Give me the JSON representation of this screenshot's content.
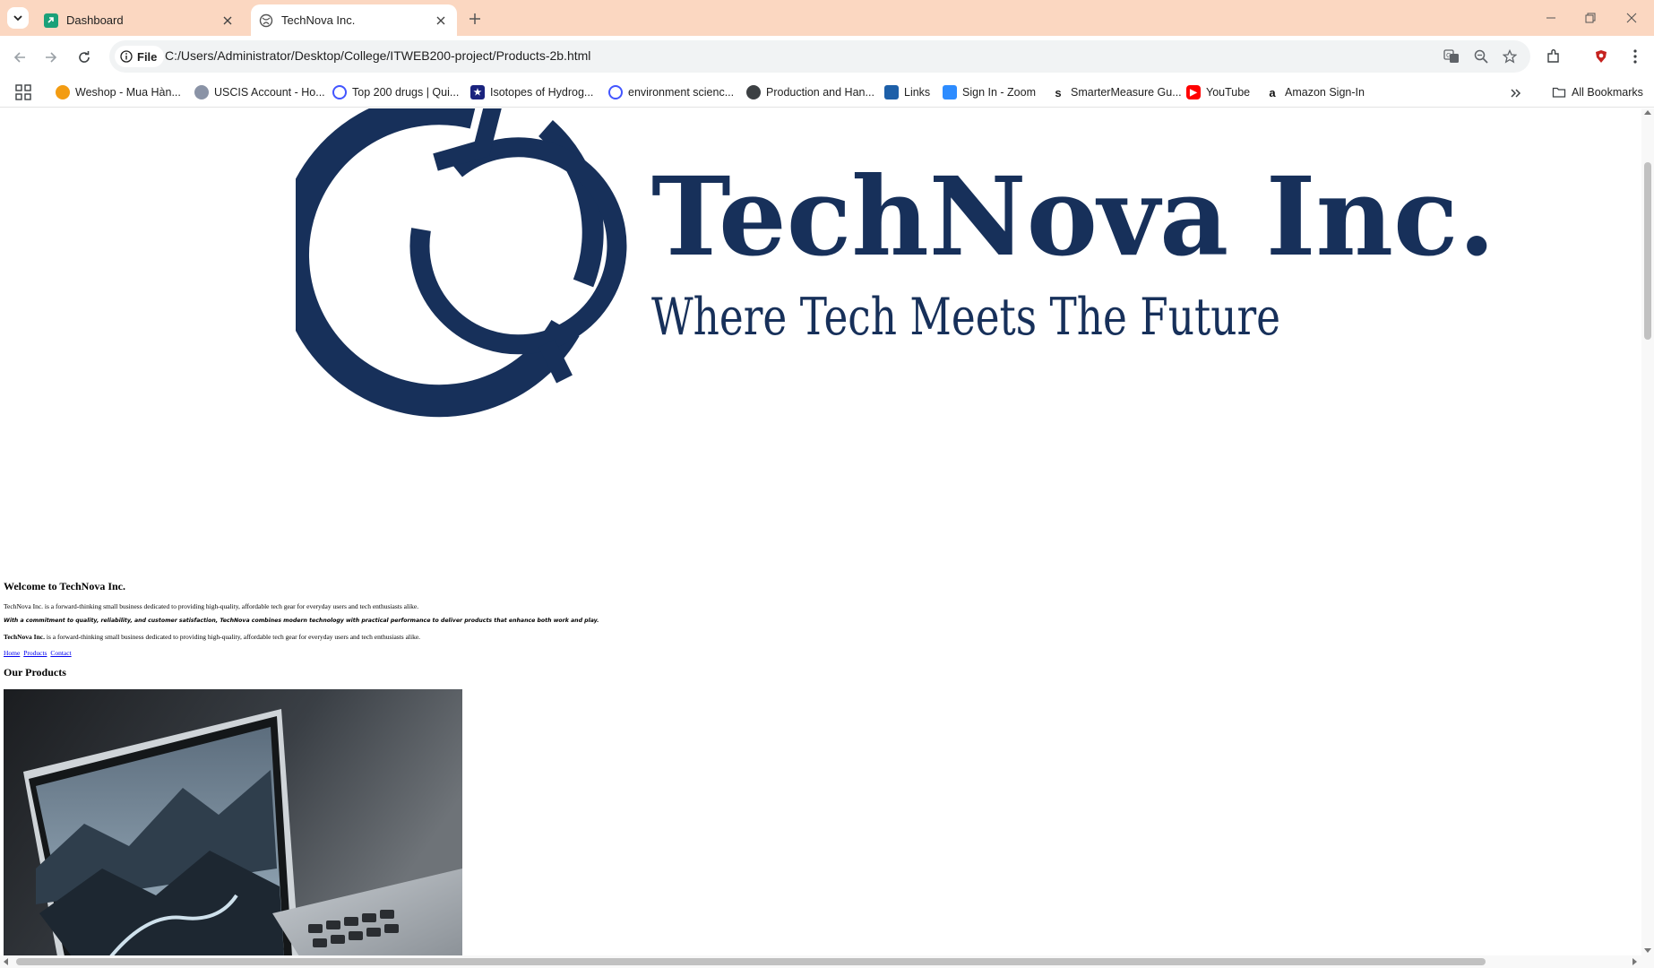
{
  "browser": {
    "tabs": [
      {
        "title": "Dashboard",
        "active": false
      },
      {
        "title": "TechNova Inc.",
        "active": true
      }
    ],
    "address": {
      "scheme_label": "File",
      "url": "C:/Users/Administrator/Desktop/College/ITWEB200-project/Products-2b.html"
    },
    "bookmarks": [
      {
        "label": "Weshop - Mua Hàn...",
        "icon": "weshop-icon"
      },
      {
        "label": "USCIS Account - Ho...",
        "icon": "uscis-icon"
      },
      {
        "label": "Top 200 drugs | Qui...",
        "icon": "quizlet-icon"
      },
      {
        "label": "Isotopes of Hydrog...",
        "icon": "star-flag-icon"
      },
      {
        "label": "environment scienc...",
        "icon": "quizlet-icon"
      },
      {
        "label": "Production and Han...",
        "icon": "globe-icon"
      },
      {
        "label": "Links",
        "icon": "links-icon"
      },
      {
        "label": "Sign In - Zoom",
        "icon": "zoom-icon"
      },
      {
        "label": "SmarterMeasure Gu...",
        "icon": "smartermeasure-icon"
      },
      {
        "label": "YouTube",
        "icon": "youtube-icon"
      },
      {
        "label": "Amazon Sign-In",
        "icon": "amazon-icon"
      }
    ],
    "all_bookmarks_label": "All Bookmarks"
  },
  "page": {
    "logo": {
      "name": "TechNova Inc.",
      "tagline": "Where Tech Meets The Future",
      "color": "#17305a"
    },
    "welcome_heading": "Welcome to TechNova Inc.",
    "paragraph_1": "TechNova Inc. is a forward-thinking small business dedicated to providing high-quality, affordable tech gear for everyday users and tech enthusiasts alike.",
    "paragraph_2": "With a commitment to quality, reliability, and customer satisfaction, TechNova combines modern technology with practical performance to deliver products that enhance both work and play.",
    "paragraph_3_bold": "TechNova Inc.",
    "paragraph_3_rest": " is a forward-thinking small business dedicated to providing high-quality, affordable tech gear for everyday users and tech enthusiasts alike.",
    "nav_links": [
      "Home",
      "Products",
      "Contact"
    ],
    "products_heading": "Our Products"
  }
}
